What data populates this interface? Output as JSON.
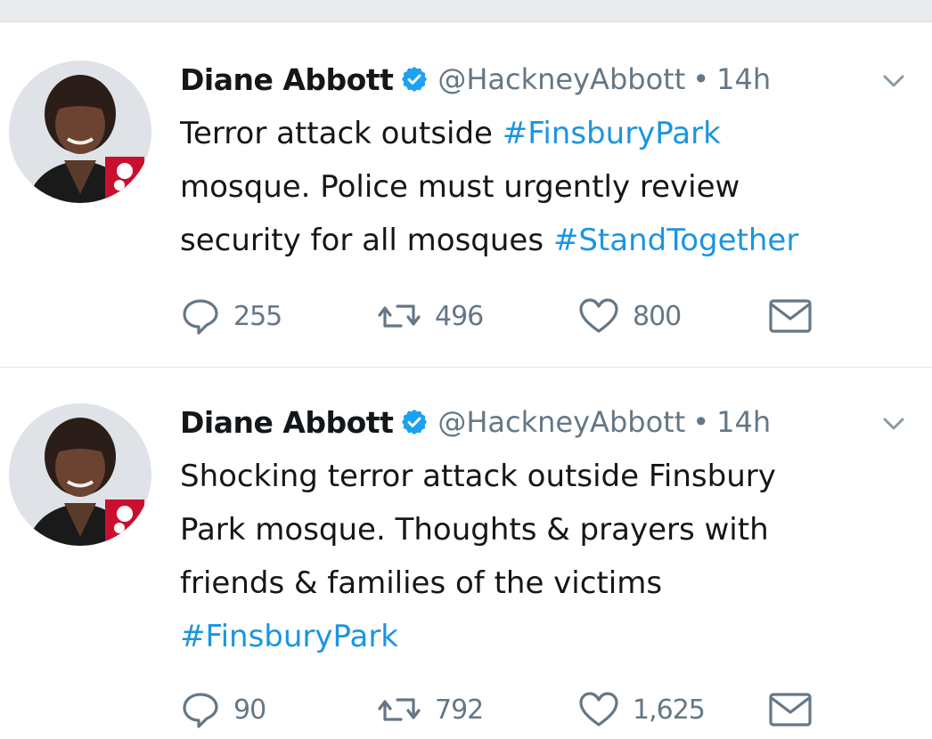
{
  "colors": {
    "link": "#1b95e0",
    "muted": "#657786",
    "verified": "#1da1f2",
    "text": "#14171a"
  },
  "icons": [
    "avatar",
    "verified-badge-icon",
    "chevron-down-icon",
    "reply-icon",
    "retweet-icon",
    "like-icon",
    "message-icon"
  ],
  "tweets": [
    {
      "name": "Diane Abbott",
      "handle": "@HackneyAbbott",
      "separator": "•",
      "time": "14h",
      "text": {
        "l1a": "Terror attack outside ",
        "l1tag": "#FinsburyPark",
        "l2": "mosque. Police must urgently review",
        "l3a": "security for all mosques ",
        "l3tag": "#StandTogether"
      },
      "replies": "255",
      "retweets": "496",
      "likes": "800"
    },
    {
      "name": "Diane Abbott",
      "handle": "@HackneyAbbott",
      "separator": "•",
      "time": "14h",
      "text": {
        "l1": "Shocking terror attack outside Finsbury",
        "l2": "Park mosque. Thoughts & prayers with",
        "l3": "friends & families of the victims",
        "l4tag": "#FinsburyPark"
      },
      "replies": "90",
      "retweets": "792",
      "likes": "1,625"
    }
  ]
}
